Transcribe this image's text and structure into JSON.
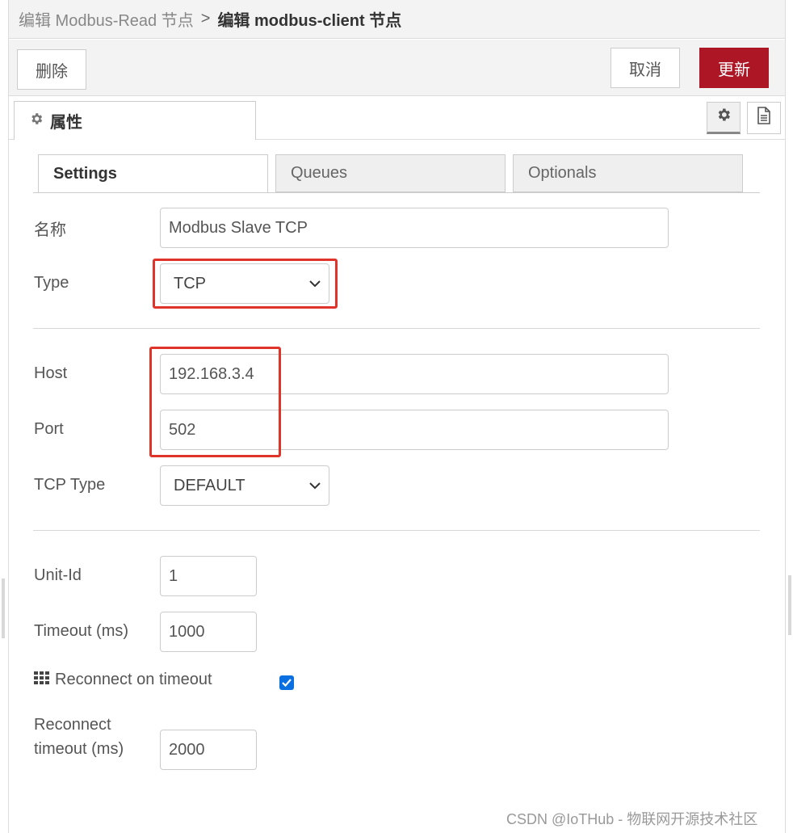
{
  "breadcrumb": {
    "parent": "编辑 Modbus-Read 节点",
    "separator": ">",
    "current": "编辑 modbus-client 节点"
  },
  "toolbar": {
    "delete_label": "删除",
    "cancel_label": "取消",
    "update_label": "更新",
    "update_color": "#ad1625"
  },
  "properties_tab": {
    "label": "属性",
    "icon": "gear-icon"
  },
  "side_icons": [
    "gear-icon",
    "document-icon"
  ],
  "subtabs": [
    "Settings",
    "Queues",
    "Optionals"
  ],
  "active_subtab": "Settings",
  "form": {
    "name": {
      "label": "名称",
      "value": "Modbus Slave TCP"
    },
    "type": {
      "label": "Type",
      "value": "TCP"
    },
    "host": {
      "label": "Host",
      "value": "192.168.3.4"
    },
    "port": {
      "label": "Port",
      "value": "502"
    },
    "tcp_type": {
      "label": "TCP Type",
      "value": "DEFAULT"
    },
    "unit_id": {
      "label": "Unit-Id",
      "value": "1"
    },
    "timeout": {
      "label": "Timeout (ms)",
      "value": "1000"
    },
    "reconnect_on_timeout": {
      "label": "Reconnect on timeout",
      "checked": true,
      "icon": "grid-icon"
    },
    "reconnect_timeout": {
      "label_line1": "Reconnect",
      "label_line2": "timeout (ms)",
      "value": "2000"
    }
  },
  "highlight_color": "#e0332a",
  "watermark": "CSDN @IoTHub - 物联网开源技术社区"
}
